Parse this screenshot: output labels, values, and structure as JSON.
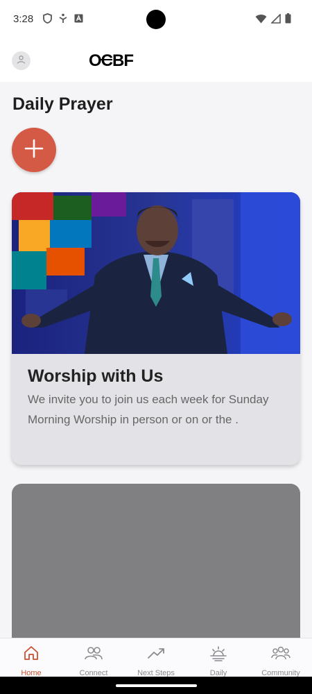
{
  "status_bar": {
    "time": "3:28",
    "icons_left": [
      "shield-icon",
      "accessibility-icon",
      "a-box-icon"
    ],
    "icons_right": [
      "wifi-icon",
      "signal-icon",
      "battery-icon"
    ]
  },
  "header": {
    "logo_text": "OCBF",
    "avatar_icon": "user-icon"
  },
  "page": {
    "title": "Daily Prayer",
    "add_button_icon": "plus-icon",
    "accent_color": "#d45a45"
  },
  "cards": [
    {
      "title": "Worship with Us",
      "description": "We invite you to join us each week for Sunday Morning Worship in person or on or the .",
      "image": "pastor-speaking-on-stage"
    },
    {
      "title": "",
      "description": "",
      "image": "placeholder-gray"
    }
  ],
  "nav": {
    "items": [
      {
        "label": "Home",
        "icon": "home-icon",
        "active": true
      },
      {
        "label": "Connect",
        "icon": "people-icon",
        "active": false
      },
      {
        "label": "Next Steps",
        "icon": "trending-up-icon",
        "active": false
      },
      {
        "label": "Daily",
        "icon": "sunrise-icon",
        "active": false
      },
      {
        "label": "Community",
        "icon": "community-icon",
        "active": false
      }
    ],
    "active_color": "#c9502f"
  }
}
